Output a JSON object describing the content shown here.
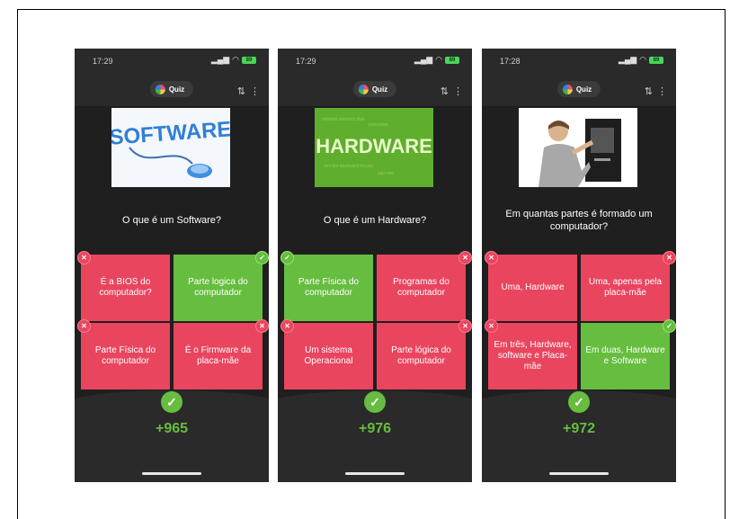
{
  "phones": [
    {
      "time": "17:29",
      "battery": "89",
      "app_label": "Quiz",
      "image_text": "SOFTWARE",
      "question": "O que é um Software?",
      "answers": [
        {
          "text": "É a BIOS do computador?",
          "color": "red",
          "mark": "wrong"
        },
        {
          "text": "Parte logica do computador",
          "color": "green",
          "mark": "right"
        },
        {
          "text": "Parte Física do computador",
          "color": "red",
          "mark": "wrong"
        },
        {
          "text": "É o Firmware da placa-mãe",
          "color": "red",
          "mark": "wrong"
        }
      ],
      "score": "+965"
    },
    {
      "time": "17:29",
      "battery": "89",
      "app_label": "Quiz",
      "image_text": "HARDWARE",
      "question": "O que é um Hardware?",
      "answers": [
        {
          "text": "Parte Física do computador",
          "color": "green",
          "mark": "right"
        },
        {
          "text": "Programas do computador",
          "color": "red",
          "mark": "wrong"
        },
        {
          "text": "Um sistema Operacional",
          "color": "red",
          "mark": "wrong"
        },
        {
          "text": "Parte lógica do computador",
          "color": "red",
          "mark": "wrong"
        }
      ],
      "score": "+976"
    },
    {
      "time": "17:28",
      "battery": "89",
      "app_label": "Quiz",
      "image_text": "",
      "question": "Em quantas partes é formado um computador?",
      "answers": [
        {
          "text": "Uma, Hardware",
          "color": "red",
          "mark": "wrong"
        },
        {
          "text": "Uma, apenas pela placa-mãe",
          "color": "red",
          "mark": "wrong"
        },
        {
          "text": "Em três, Hardware, software e Placa-mãe",
          "color": "red",
          "mark": "wrong"
        },
        {
          "text": "Em duas, Hardware e Software",
          "color": "green",
          "mark": "right"
        }
      ],
      "score": "+972"
    }
  ],
  "colors": {
    "correct": "#66bd3f",
    "incorrect": "#e9455f",
    "background": "#1f1f1f"
  }
}
